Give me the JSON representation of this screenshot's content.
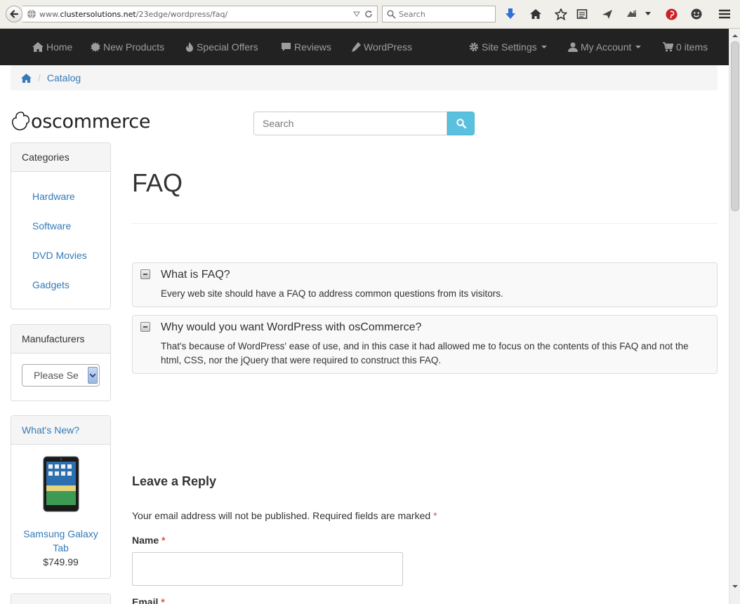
{
  "browser": {
    "url_prefix": "www.",
    "url_domain": "clustersolutions.net",
    "url_path": "/23edge/wordpress/faq/",
    "search_placeholder": "Search"
  },
  "navbar": {
    "items": [
      {
        "label": "Home",
        "icon": "home-icon"
      },
      {
        "label": "New Products",
        "icon": "certificate-icon"
      },
      {
        "label": "Special Offers",
        "icon": "fire-icon"
      },
      {
        "label": "Reviews",
        "icon": "comment-icon"
      },
      {
        "label": "WordPress",
        "icon": "pencil-icon"
      }
    ],
    "site_settings": "Site Settings",
    "my_account": "My Account",
    "cart": "0 items"
  },
  "breadcrumb": {
    "items": [
      "Catalog"
    ]
  },
  "logo": {
    "text": "oscommerce"
  },
  "search": {
    "placeholder": "Search"
  },
  "categories": {
    "title": "Categories",
    "items": [
      "Hardware",
      "Software",
      "DVD Movies",
      "Gadgets"
    ]
  },
  "manufacturers": {
    "title": "Manufacturers",
    "selected": "Please Se"
  },
  "whats_new": {
    "title": "What's New?",
    "product_name": "Samsung Galaxy Tab",
    "price": "$749.99"
  },
  "faq": {
    "title": "FAQ",
    "items": [
      {
        "question": "What is FAQ?",
        "answer": "Every web site should have a FAQ to address common questions from its visitors."
      },
      {
        "question": "Why would you want WordPress with osCommerce?",
        "answer": "That's because of WordPress' ease of use, and in this case it had allowed me to focus on the contents of this FAQ and not the html, CSS, nor the jQuery that were required to construct this FAQ."
      }
    ]
  },
  "reply": {
    "title": "Leave a Reply",
    "note": "Your email address will not be published. Required fields are marked",
    "required_mark": "*",
    "name_label": "Name",
    "email_label": "Email"
  },
  "colors": {
    "navbar_bg": "#222222",
    "link": "#337ab7",
    "search_button": "#5bc0de"
  }
}
